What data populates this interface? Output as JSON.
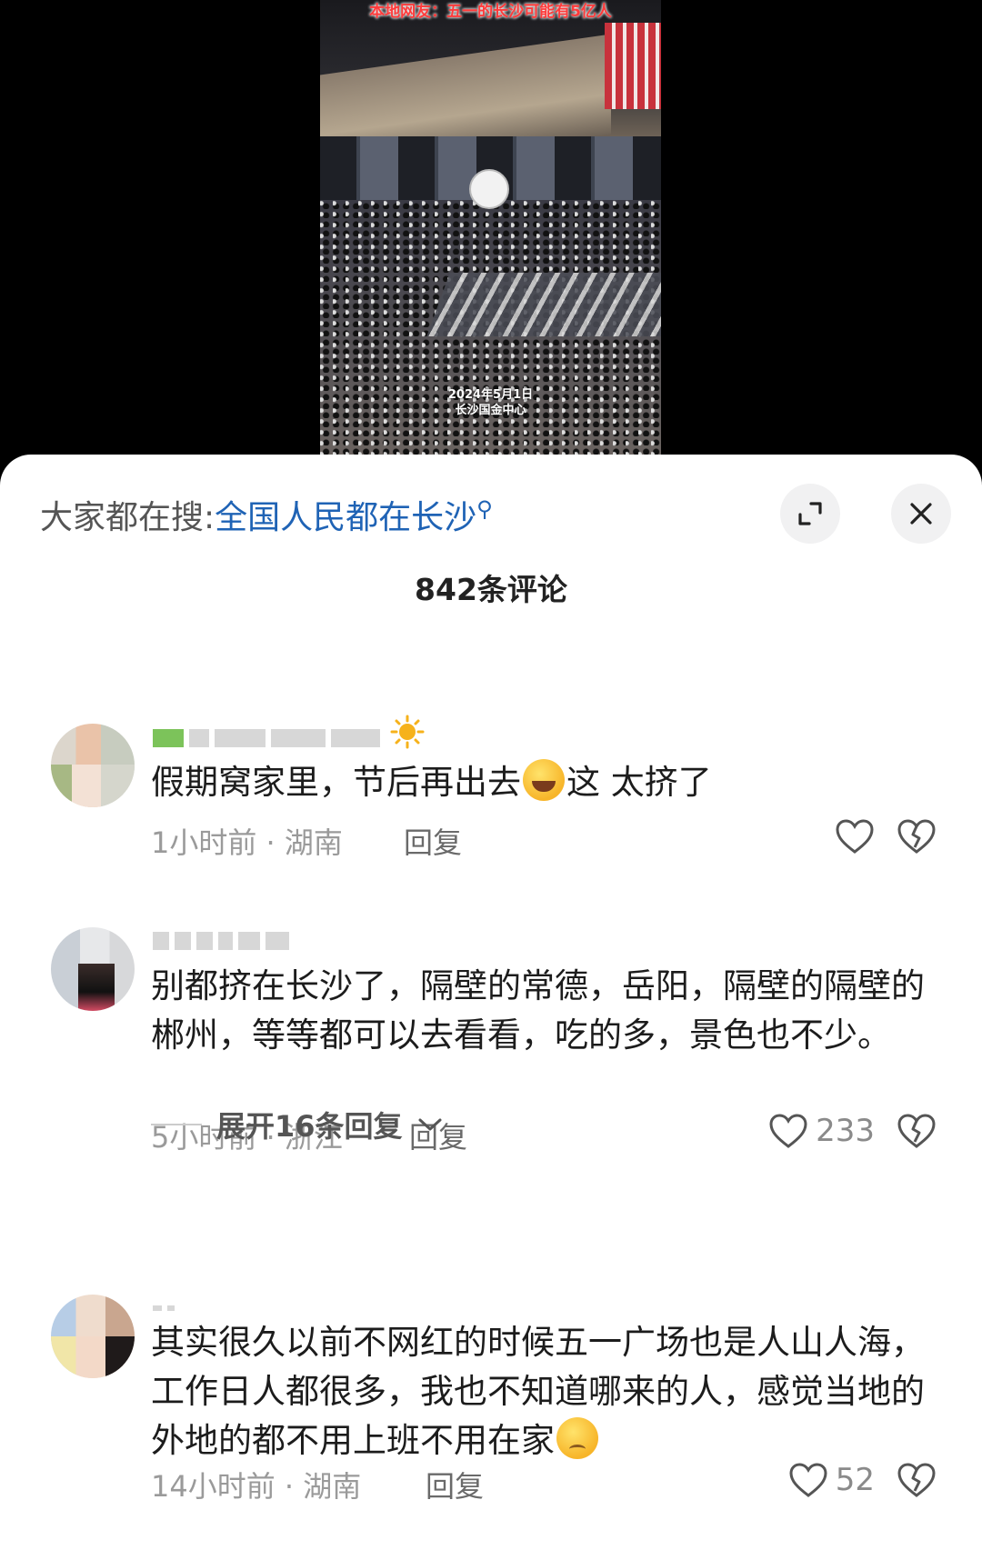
{
  "video": {
    "caption": "本地网友：五一的长沙可能有5亿人",
    "date_stamp": "2024年5月1日",
    "location_stamp": "长沙国金中心"
  },
  "sheet": {
    "search_prefix": "大家都在搜:",
    "search_term": "全国人民都在长沙",
    "comment_count": "842条评论",
    "expand_icon": "expand-icon",
    "close_icon": "close-icon"
  },
  "comments": [
    {
      "text_parts": [
        "假期窝家里，节后再出去",
        "这 太挤了"
      ],
      "emoji": "rolling-laughing-emoji",
      "user_badge": "sun-emoji",
      "time": "1小时前 · 湖南",
      "reply": "回复",
      "likes": ""
    },
    {
      "text": "别都挤在长沙了，隔壁的常德，岳阳，隔壁的隔壁的郴州，等等都可以去看看，吃的多，景色也不少。",
      "time": "5小时前 · 浙江",
      "reply": "回复",
      "likes": "233",
      "expand_replies": "展开16条回复"
    },
    {
      "text": "其实很久以前不网红的时候五一广场也是人山人海，工作日人都很多，我也不知道哪来的人，感觉当地的外地的都不用上班不用在家",
      "emoji": "sad-emoji",
      "time": "14小时前 · 湖南",
      "reply": "回复",
      "likes": "52"
    }
  ],
  "colors": {
    "search_term": "#1f63b5",
    "meta_text": "#9a9a9a",
    "sheet_bg": "#ffffff"
  }
}
